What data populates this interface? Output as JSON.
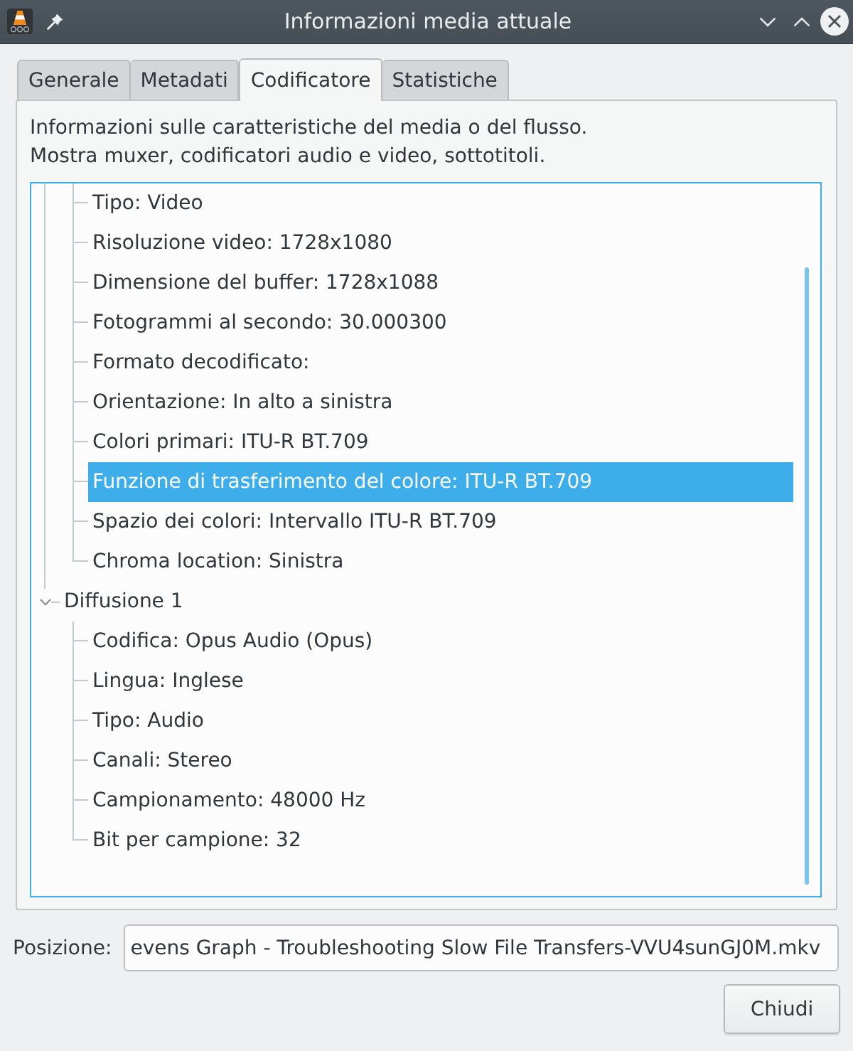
{
  "window": {
    "title": "Informazioni media attuale"
  },
  "tabs": [
    {
      "label": "Generale",
      "selected": false
    },
    {
      "label": "Metadati",
      "selected": false
    },
    {
      "label": "Codificatore",
      "selected": true
    },
    {
      "label": "Statistiche",
      "selected": false
    }
  ],
  "description": [
    "Informazioni sulle caratteristiche del media o del flusso.",
    "Mostra muxer, codificatori audio e video, sottotitoli."
  ],
  "tree": {
    "items": [
      {
        "children": [
          {
            "label": "Tipo: Video",
            "selected": false
          },
          {
            "label": "Risoluzione video: 1728x1080",
            "selected": false
          },
          {
            "label": "Dimensione del buffer: 1728x1088",
            "selected": false
          },
          {
            "label": "Fotogrammi al secondo: 30.000300",
            "selected": false
          },
          {
            "label": "Formato decodificato:",
            "selected": false
          },
          {
            "label": "Orientazione: In alto a sinistra",
            "selected": false
          },
          {
            "label": "Colori primari: ITU-R BT.709",
            "selected": false
          },
          {
            "label": "Funzione di trasferimento del colore: ITU-R BT.709",
            "selected": true
          },
          {
            "label": "Spazio dei colori: Intervallo ITU-R BT.709",
            "selected": false
          },
          {
            "label": "Chroma location: Sinistra",
            "selected": false
          }
        ]
      },
      {
        "label": "Diffusione 1",
        "expanded": true,
        "selected": false,
        "children": [
          {
            "label": "Codifica: Opus Audio (Opus)",
            "selected": false
          },
          {
            "label": "Lingua: Inglese",
            "selected": false
          },
          {
            "label": "Tipo: Audio",
            "selected": false
          },
          {
            "label": "Canali: Stereo",
            "selected": false
          },
          {
            "label": "Campionamento: 48000 Hz",
            "selected": false
          },
          {
            "label": "Bit per campione: 32",
            "selected": false
          }
        ]
      }
    ]
  },
  "location": {
    "label": "Posizione:",
    "value": "evens Graph - Troubleshooting Slow File Transfers-VVU4sunGJ0M.mkv"
  },
  "buttons": [
    {
      "label": "Chiudi"
    }
  ]
}
